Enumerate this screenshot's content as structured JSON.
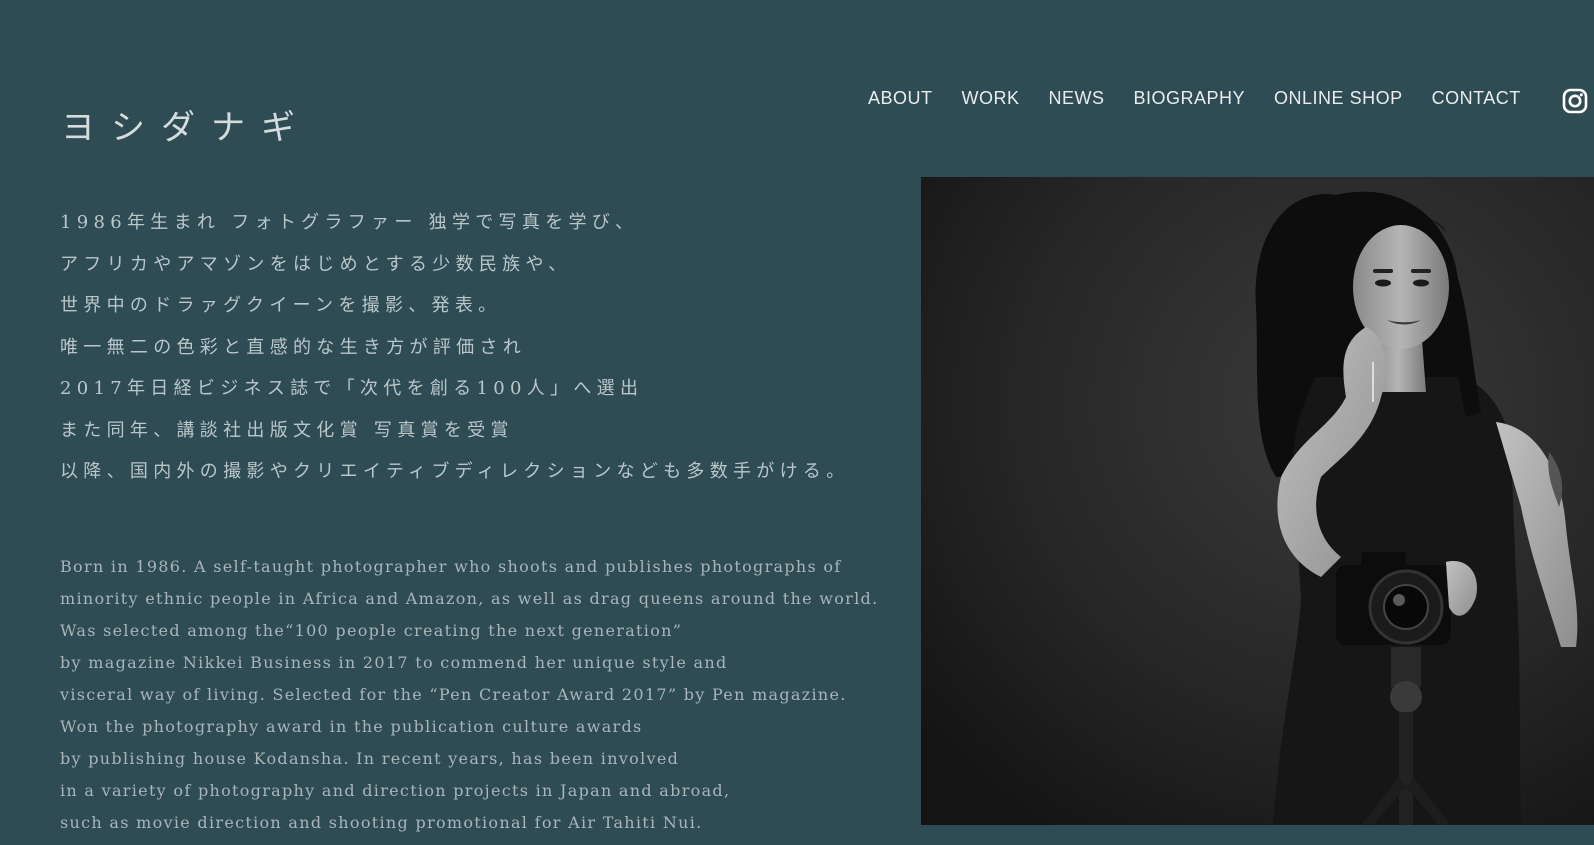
{
  "site": {
    "title": "ヨシダナギ"
  },
  "nav": {
    "items": [
      {
        "label": "ABOUT"
      },
      {
        "label": "WORK"
      },
      {
        "label": "NEWS"
      },
      {
        "label": "BIOGRAPHY"
      },
      {
        "label": "ONLINE SHOP"
      },
      {
        "label": "CONTACT"
      }
    ],
    "social_icon": "instagram-icon"
  },
  "bio_jp": {
    "lines": [
      "1986年生まれ フォトグラファー 独学で写真を学び、",
      "アフリカやアマゾンをはじめとする少数民族や、",
      "世界中のドラァグクイーンを撮影、発表。",
      "唯一無二の色彩と直感的な生き方が評価され",
      "2017年日経ビジネス誌で「次代を創る100人」へ選出",
      "また同年、講談社出版文化賞 写真賞を受賞",
      "以降、国内外の撮影やクリエイティブディレクションなども多数手がける。"
    ]
  },
  "bio_en": {
    "lines": [
      "Born in 1986. A self-taught photographer who shoots and publishes photographs of",
      "minority ethnic people in Africa and Amazon, as well as drag queens around the world.",
      "Was selected among the“100 people creating the next generation”",
      "by magazine Nikkei Business in 2017 to commend her unique style and",
      "visceral way of living. Selected for the “Pen Creator Award 2017” by Pen magazine.",
      "Won the photography award in the publication culture awards",
      "by publishing house Kodansha. In recent years, has been involved",
      "in a variety of photography and direction projects in Japan and abroad,",
      "such as movie direction and shooting promotional for Air Tahiti Nui."
    ]
  },
  "colors": {
    "background": "#2f4b53",
    "nav_text": "#e8eef0",
    "title_text": "#d4dcde",
    "bio_jp_text": "#b9c7cb",
    "bio_en_text": "#a8b6ba"
  }
}
